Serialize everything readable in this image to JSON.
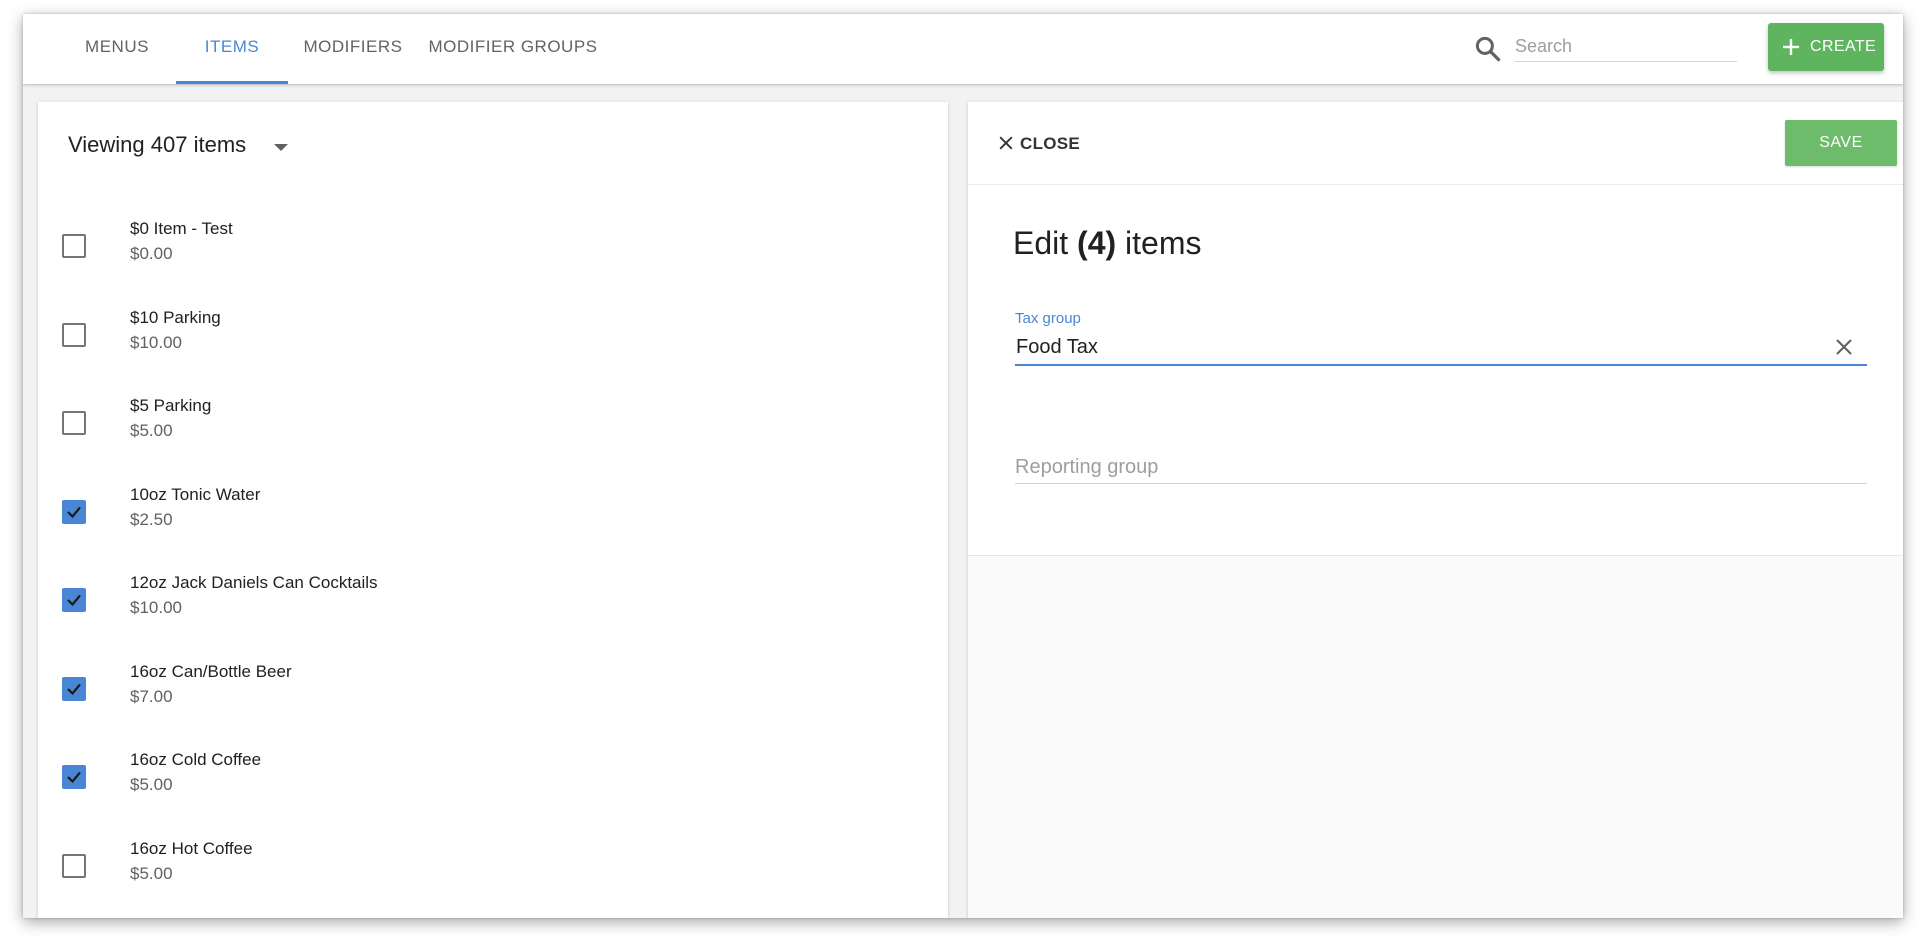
{
  "nav": {
    "tabs": [
      {
        "label": "MENUS",
        "active": false
      },
      {
        "label": "ITEMS",
        "active": true
      },
      {
        "label": "MODIFIERS",
        "active": false
      },
      {
        "label": "MODIFIER GROUPS",
        "active": false
      }
    ],
    "search_placeholder": "Search",
    "create_label": "CREATE"
  },
  "list": {
    "viewing_prefix": "Viewing ",
    "viewing_count": "407",
    "viewing_suffix": " items",
    "items": [
      {
        "name": "$0 Item - Test",
        "price": "$0.00",
        "checked": false
      },
      {
        "name": "$10 Parking",
        "price": "$10.00",
        "checked": false
      },
      {
        "name": "$5 Parking",
        "price": "$5.00",
        "checked": false
      },
      {
        "name": "10oz Tonic Water",
        "price": "$2.50",
        "checked": true
      },
      {
        "name": "12oz Jack Daniels Can Cocktails",
        "price": "$10.00",
        "checked": true
      },
      {
        "name": "16oz Can/Bottle Beer",
        "price": "$7.00",
        "checked": true
      },
      {
        "name": "16oz Cold Coffee",
        "price": "$5.00",
        "checked": true
      },
      {
        "name": "16oz Hot Coffee",
        "price": "$5.00",
        "checked": false
      }
    ]
  },
  "edit": {
    "close_label": "CLOSE",
    "save_label": "SAVE",
    "title_prefix": "Edit ",
    "title_count": "(4)",
    "title_suffix": " items",
    "tax_group_label": "Tax group",
    "tax_group_value": "Food Tax",
    "reporting_group_placeholder": "Reporting group"
  },
  "colors": {
    "accent": "#4a86d6",
    "create_green": "#5fb55f",
    "save_green": "#6cbc6c"
  },
  "icons": {
    "search": "search-icon",
    "create": "plus-icon",
    "caret": "caret-down-icon",
    "close": "close-icon",
    "clear": "clear-icon",
    "check": "checkmark-icon"
  }
}
